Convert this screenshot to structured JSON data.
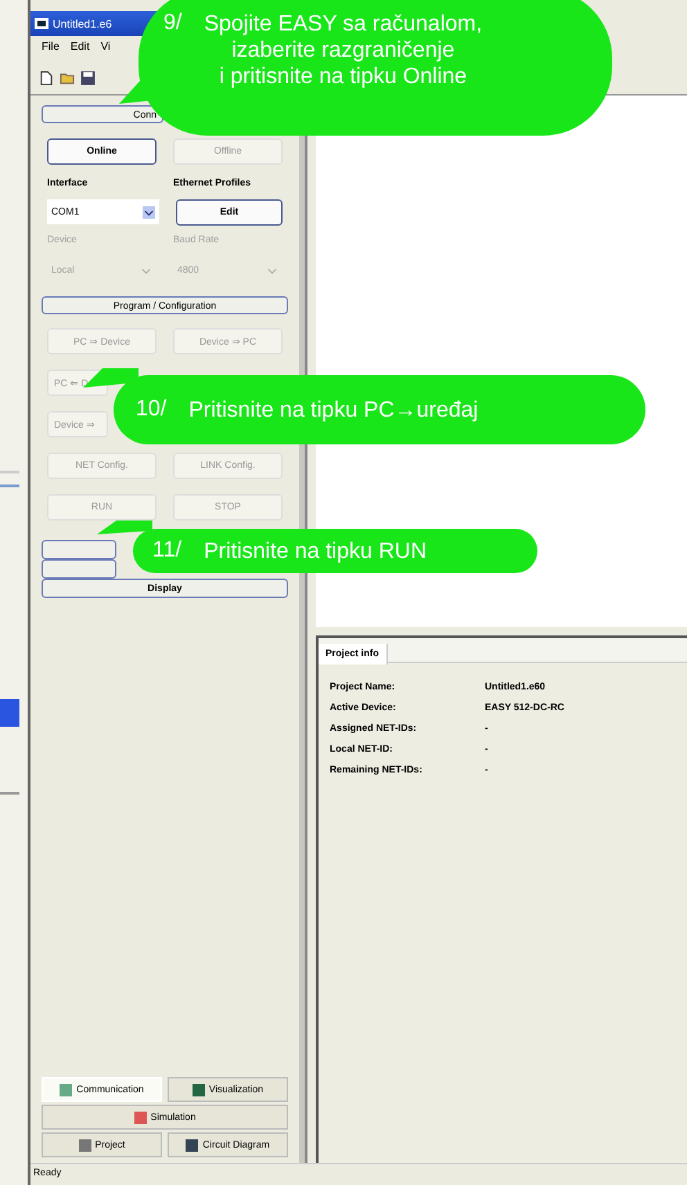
{
  "window": {
    "title": "Untitled1.e6"
  },
  "menu": [
    "File",
    "Edit",
    "Vi"
  ],
  "panel": {
    "connection_header": "Conn",
    "connect_buttons": [
      {
        "label": "Online",
        "disabled": false
      },
      {
        "label": "Offline",
        "disabled": true
      }
    ],
    "interface": {
      "label": "Interface",
      "value": "COM1"
    },
    "ethernet": {
      "label": "Ethernet Profiles",
      "button": "Edit"
    },
    "device": {
      "label": "Device",
      "value": "Local",
      "disabled": true
    },
    "baud": {
      "label": "Baud Rate",
      "value": "4800",
      "disabled": true
    },
    "program_header": "Program / Configuration",
    "program_rows": [
      [
        {
          "label": "PC ⇒ Device",
          "disabled": true
        },
        {
          "label": "Device ⇒ PC",
          "disabled": true
        }
      ],
      [
        {
          "label": "PC ⇐ D",
          "disabled": true
        }
      ],
      [
        {
          "label": "Device ⇒",
          "disabled": true
        }
      ],
      [
        {
          "label": "NET Config.",
          "disabled": true
        },
        {
          "label": "LINK Config.",
          "disabled": true
        }
      ],
      [
        {
          "label": "RUN",
          "disabled": true
        },
        {
          "label": "STOP",
          "disabled": true
        }
      ]
    ],
    "display_header": "Display",
    "tabs": [
      {
        "label": "Communication",
        "selected": true
      },
      {
        "label": "Visualization",
        "selected": false
      },
      {
        "label": "Simulation",
        "selected": false
      },
      {
        "label": "Project",
        "selected": false
      },
      {
        "label": "Circuit Diagram",
        "selected": false
      }
    ]
  },
  "project_info": {
    "tab": "Project info",
    "rows": [
      {
        "label": "Project Name:",
        "value": "Untitled1.e60"
      },
      {
        "label": "Active Device:",
        "value": "EASY 512-DC-RC"
      },
      {
        "label": "Assigned NET-IDs:",
        "value": "-"
      },
      {
        "label": "Local NET-ID:",
        "value": "-"
      },
      {
        "label": "Remaining NET-IDs:",
        "value": "-"
      }
    ]
  },
  "status_bar": "Ready",
  "callouts": [
    {
      "number": "9/",
      "lines": [
        "Spojite EASY sa računalom,",
        "izaberite razgraničenje",
        "i pritisnite na tipku Online"
      ]
    },
    {
      "number": "10/",
      "lines": [
        "Pritisnite na tipku PC→uređaj"
      ]
    },
    {
      "number": "11/",
      "lines": [
        "Pritisnite na tipku RUN"
      ]
    }
  ]
}
